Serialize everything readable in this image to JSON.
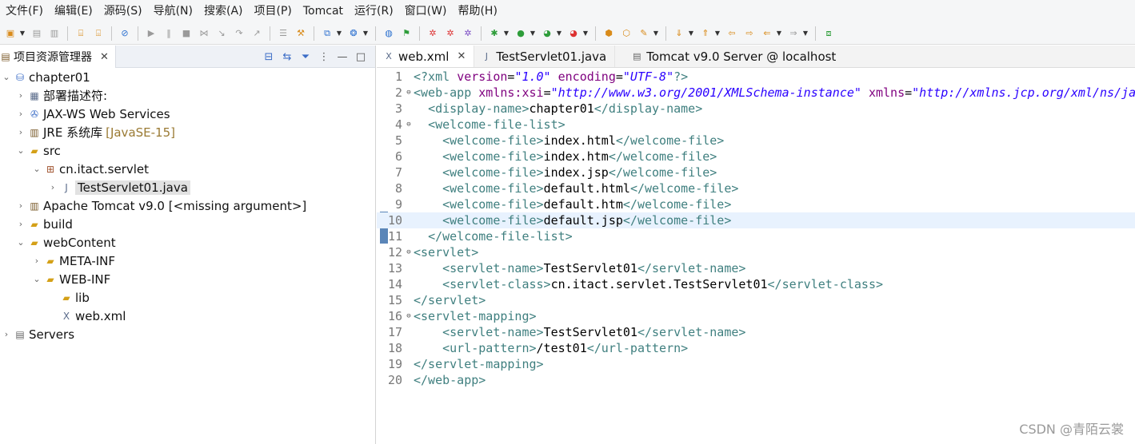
{
  "menu": {
    "items": [
      "文件(F)",
      "编辑(E)",
      "源码(S)",
      "导航(N)",
      "搜索(A)",
      "项目(P)",
      "Tomcat",
      "运行(R)",
      "窗口(W)",
      "帮助(H)"
    ]
  },
  "explorer": {
    "tab_label": "项目资源管理器",
    "tree": [
      {
        "label": "chapter01",
        "decor": ""
      },
      {
        "label": "部署描述符:",
        "decor": ""
      },
      {
        "label": "JAX-WS Web Services",
        "decor": ""
      },
      {
        "label": "JRE 系统库",
        "decor": "[JavaSE-15]"
      },
      {
        "label": "src",
        "decor": ""
      },
      {
        "label": "cn.itact.servlet",
        "decor": ""
      },
      {
        "label": "TestServlet01.java",
        "decor": ""
      },
      {
        "label": "Apache Tomcat v9.0 [<missing argument>]",
        "decor": ""
      },
      {
        "label": "build",
        "decor": ""
      },
      {
        "label": "webContent",
        "decor": ""
      },
      {
        "label": "META-INF",
        "decor": ""
      },
      {
        "label": "WEB-INF",
        "decor": ""
      },
      {
        "label": "lib",
        "decor": ""
      },
      {
        "label": "web.xml",
        "decor": ""
      },
      {
        "label": "Servers",
        "decor": ""
      }
    ]
  },
  "editor": {
    "tabs": [
      "web.xml",
      "TestServlet01.java",
      "Tomcat v9.0 Server @ localhost"
    ],
    "lines": [
      {
        "n": "1",
        "fold": "",
        "parts": [
          [
            "pi",
            "<?xml "
          ],
          [
            "attr",
            "version"
          ],
          [
            "txt",
            "="
          ],
          [
            "val",
            "\"1.0\""
          ],
          [
            "txt",
            " "
          ],
          [
            "attr",
            "encoding"
          ],
          [
            "txt",
            "="
          ],
          [
            "val",
            "\"UTF-8\""
          ],
          [
            "pi",
            "?>"
          ]
        ]
      },
      {
        "n": "2",
        "fold": "⊖",
        "parts": [
          [
            "tag",
            "<web-app "
          ],
          [
            "attr",
            "xmlns:xsi"
          ],
          [
            "txt",
            "="
          ],
          [
            "val",
            "\"http://www.w3.org/2001/XMLSchema-instance\""
          ],
          [
            "txt",
            " "
          ],
          [
            "attr",
            "xmlns"
          ],
          [
            "txt",
            "="
          ],
          [
            "val",
            "\"http://xmlns.jcp.org/xml/ns/javaee\""
          ]
        ]
      },
      {
        "n": "3",
        "fold": "",
        "parts": [
          [
            "txt",
            "  "
          ],
          [
            "tag",
            "<display-name>"
          ],
          [
            "txt",
            "chapter01"
          ],
          [
            "tag",
            "</display-name>"
          ]
        ]
      },
      {
        "n": "4",
        "fold": "⊖",
        "parts": [
          [
            "txt",
            "  "
          ],
          [
            "tag",
            "<welcome-file-list>"
          ]
        ]
      },
      {
        "n": "5",
        "fold": "",
        "parts": [
          [
            "txt",
            "    "
          ],
          [
            "tag",
            "<welcome-file>"
          ],
          [
            "txt",
            "index.html"
          ],
          [
            "tag",
            "</welcome-file>"
          ]
        ]
      },
      {
        "n": "6",
        "fold": "",
        "parts": [
          [
            "txt",
            "    "
          ],
          [
            "tag",
            "<welcome-file>"
          ],
          [
            "txt",
            "index.htm"
          ],
          [
            "tag",
            "</welcome-file>"
          ]
        ]
      },
      {
        "n": "7",
        "fold": "",
        "parts": [
          [
            "txt",
            "    "
          ],
          [
            "tag",
            "<welcome-file>"
          ],
          [
            "txt",
            "index.jsp"
          ],
          [
            "tag",
            "</welcome-file>"
          ]
        ]
      },
      {
        "n": "8",
        "fold": "",
        "parts": [
          [
            "txt",
            "    "
          ],
          [
            "tag",
            "<welcome-file>"
          ],
          [
            "txt",
            "default.html"
          ],
          [
            "tag",
            "</welcome-file>"
          ]
        ]
      },
      {
        "n": "9",
        "fold": "",
        "parts": [
          [
            "txt",
            "    "
          ],
          [
            "tag",
            "<welcome-file>"
          ],
          [
            "txt",
            "default.htm"
          ],
          [
            "tag",
            "</welcome-file>"
          ]
        ]
      },
      {
        "n": "10",
        "fold": "",
        "parts": [
          [
            "txt",
            "    "
          ],
          [
            "tag",
            "<welcome-file>"
          ],
          [
            "txt",
            "default.jsp"
          ],
          [
            "tag",
            "</welcome-file>"
          ]
        ]
      },
      {
        "n": "11",
        "fold": "",
        "parts": [
          [
            "txt",
            "  "
          ],
          [
            "tag",
            "</welcome-file-list>"
          ]
        ]
      },
      {
        "n": "12",
        "fold": "⊖",
        "parts": [
          [
            "tag",
            "<servlet>"
          ]
        ]
      },
      {
        "n": "13",
        "fold": "",
        "parts": [
          [
            "txt",
            "    "
          ],
          [
            "tag",
            "<servlet-name>"
          ],
          [
            "txt",
            "TestServlet01"
          ],
          [
            "tag",
            "</servlet-name>"
          ]
        ]
      },
      {
        "n": "14",
        "fold": "",
        "parts": [
          [
            "txt",
            "    "
          ],
          [
            "tag",
            "<servlet-class>"
          ],
          [
            "txt",
            "cn.itact.servlet.TestServlet01"
          ],
          [
            "tag",
            "</servlet-class>"
          ]
        ]
      },
      {
        "n": "15",
        "fold": "",
        "parts": [
          [
            "tag",
            "</servlet>"
          ]
        ]
      },
      {
        "n": "16",
        "fold": "⊖",
        "parts": [
          [
            "tag",
            "<servlet-mapping>"
          ]
        ]
      },
      {
        "n": "17",
        "fold": "",
        "parts": [
          [
            "txt",
            "    "
          ],
          [
            "tag",
            "<servlet-name>"
          ],
          [
            "txt",
            "TestServlet01"
          ],
          [
            "tag",
            "</servlet-name>"
          ]
        ]
      },
      {
        "n": "18",
        "fold": "",
        "parts": [
          [
            "txt",
            "    "
          ],
          [
            "tag",
            "<url-pattern>"
          ],
          [
            "txt",
            "/test01"
          ],
          [
            "tag",
            "</url-pattern>"
          ]
        ]
      },
      {
        "n": "19",
        "fold": "",
        "parts": [
          [
            "tag",
            "</servlet-mapping>"
          ]
        ]
      },
      {
        "n": "20",
        "fold": "",
        "parts": [
          [
            "tag",
            "</web-app>"
          ]
        ]
      }
    ]
  },
  "watermark": "CSDN @青陌云裳",
  "colors": {
    "tag": "#3f7f7f",
    "attr": "#7f007f",
    "value": "#2a00ff",
    "highlight": "#e8f2fe"
  }
}
